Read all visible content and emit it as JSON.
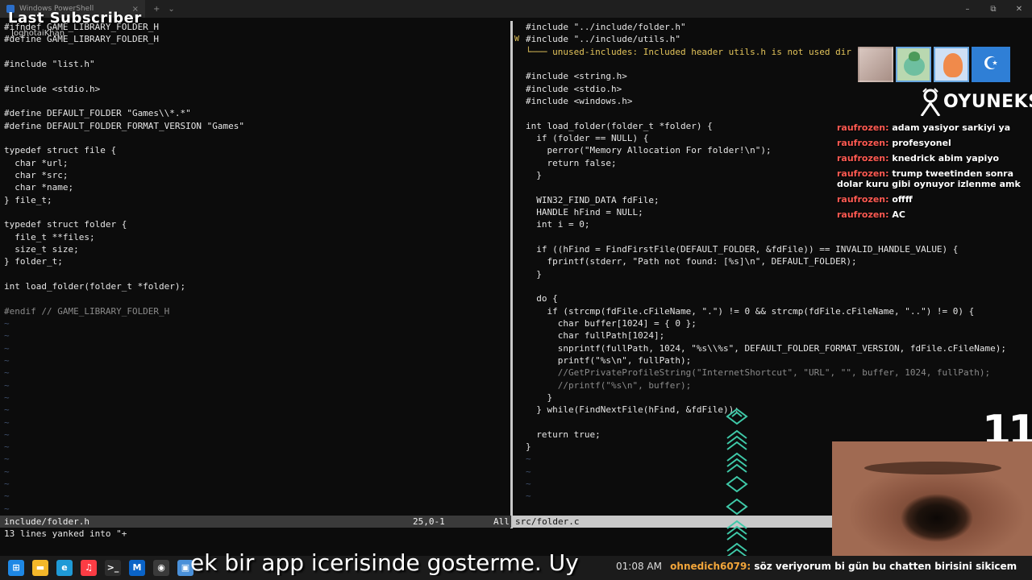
{
  "window": {
    "tab_title": "Windows PowerShell",
    "tab_close": "×",
    "new_tab": "+",
    "dropdown": "⌄",
    "controls": [
      "–",
      "⧉",
      "✕"
    ]
  },
  "overlay": {
    "last_subscriber_label": "Last Subscriber",
    "last_subscriber_name": "JoghotaiKhan"
  },
  "left_editor": {
    "lines": [
      "#ifndef GAME_LIBRARY_FOLDER_H",
      "#define GAME_LIBRARY_FOLDER_H",
      "",
      "#include \"list.h\"",
      "",
      "#include <stdio.h>",
      "",
      "#define DEFAULT_FOLDER \"Games\\\\*.*\"",
      "#define DEFAULT_FOLDER_FORMAT_VERSION \"Games\"",
      "",
      "typedef struct file {",
      "  char *url;",
      "  char *src;",
      "  char *name;",
      "} file_t;",
      "",
      "typedef struct folder {",
      "  file_t **files;",
      "  size_t size;",
      "} folder_t;",
      "",
      "int load_folder(folder_t *folder);",
      "",
      "#endif // GAME_LIBRARY_FOLDER_H"
    ],
    "tilde_count": 16,
    "status_name": "include/folder.h",
    "status_pos": "25,0-1",
    "status_pct": "All",
    "command_line": "13 lines yanked into \"+"
  },
  "right_editor": {
    "sign": "W",
    "lines": [
      "#include \"../include/folder.h\"",
      "#include \"../include/utils.h\"",
      "└─── unused-includes: Included header utils.h is not used dir",
      "",
      "#include <string.h>",
      "#include <stdio.h>",
      "#include <windows.h>",
      "",
      "int load_folder(folder_t *folder) {",
      "  if (folder == NULL) {",
      "    perror(\"Memory Allocation For folder!\\n\");",
      "    return false;",
      "  }",
      "",
      "  WIN32_FIND_DATA fdFile;",
      "  HANDLE hFind = NULL;",
      "  int i = 0;",
      "",
      "  if ((hFind = FindFirstFile(DEFAULT_FOLDER, &fdFile)) == INVALID_HANDLE_VALUE) {",
      "    fprintf(stderr, \"Path not found: [%s]\\n\", DEFAULT_FOLDER);",
      "  }",
      "",
      "  do {",
      "    if (strcmp(fdFile.cFileName, \".\") != 0 && strcmp(fdFile.cFileName, \"..\") != 0) {",
      "      char buffer[1024] = { 0 };",
      "      char fullPath[1024];",
      "      snprintf(fullPath, 1024, \"%s\\\\%s\", DEFAULT_FOLDER_FORMAT_VERSION, fdFile.cFileName);",
      "      printf(\"%s\\n\", fullPath);",
      "      //GetPrivateProfileString(\"InternetShortcut\", \"URL\", \"\", buffer, 1024, fullPath);",
      "      //printf(\"%s\\n\", buffer);",
      "    }",
      "  } while(FindNextFile(hFind, &fdFile));",
      "",
      "  return true;",
      "}"
    ],
    "tilde_count": 4,
    "status_name": "src/folder.c"
  },
  "brand": {
    "name": "OYUNEKS"
  },
  "chat": [
    {
      "user": "raufrozen:",
      "text": "adam yasiyor sarkiyi ya"
    },
    {
      "user": "raufrozen:",
      "text": "profesyonel"
    },
    {
      "user": "raufrozen:",
      "text": "knedrick abim yapiyo"
    },
    {
      "user": "raufrozen:",
      "text": "trump tweetinden sonra dolar kuru gibi oynuyor izlenme amk"
    },
    {
      "user": "raufrozen:",
      "text": "offff"
    },
    {
      "user": "raufrozen:",
      "text": "AC"
    }
  ],
  "counter": "11",
  "avatars": {
    "crescent_symbol": "☪"
  },
  "taskbar": {
    "apps": [
      {
        "name": "windows-start",
        "glyph": "⊞",
        "color": "#1e88e5"
      },
      {
        "name": "file-explorer",
        "glyph": "▬",
        "color": "#f3b72a"
      },
      {
        "name": "edge",
        "glyph": "e",
        "color": "#1f9ad6"
      },
      {
        "name": "music",
        "glyph": "♫",
        "color": "#fc3c44"
      },
      {
        "name": "terminal",
        "glyph": ">_",
        "color": "#2d2d2d"
      },
      {
        "name": "m-app",
        "glyph": "M",
        "color": "#0a63c7"
      },
      {
        "name": "obs",
        "glyph": "◉",
        "color": "#3a3a3a"
      },
      {
        "name": "app-window",
        "glyph": "▣",
        "color": "#4a90d9"
      }
    ]
  },
  "subtitle": "ek bir app icerisinde gosterme. Uy",
  "ticker": {
    "time": "01:08 AM",
    "user": "ohnedich6079:",
    "text": "söz veriyorum bi gün bu chatten birisini sikicem"
  }
}
